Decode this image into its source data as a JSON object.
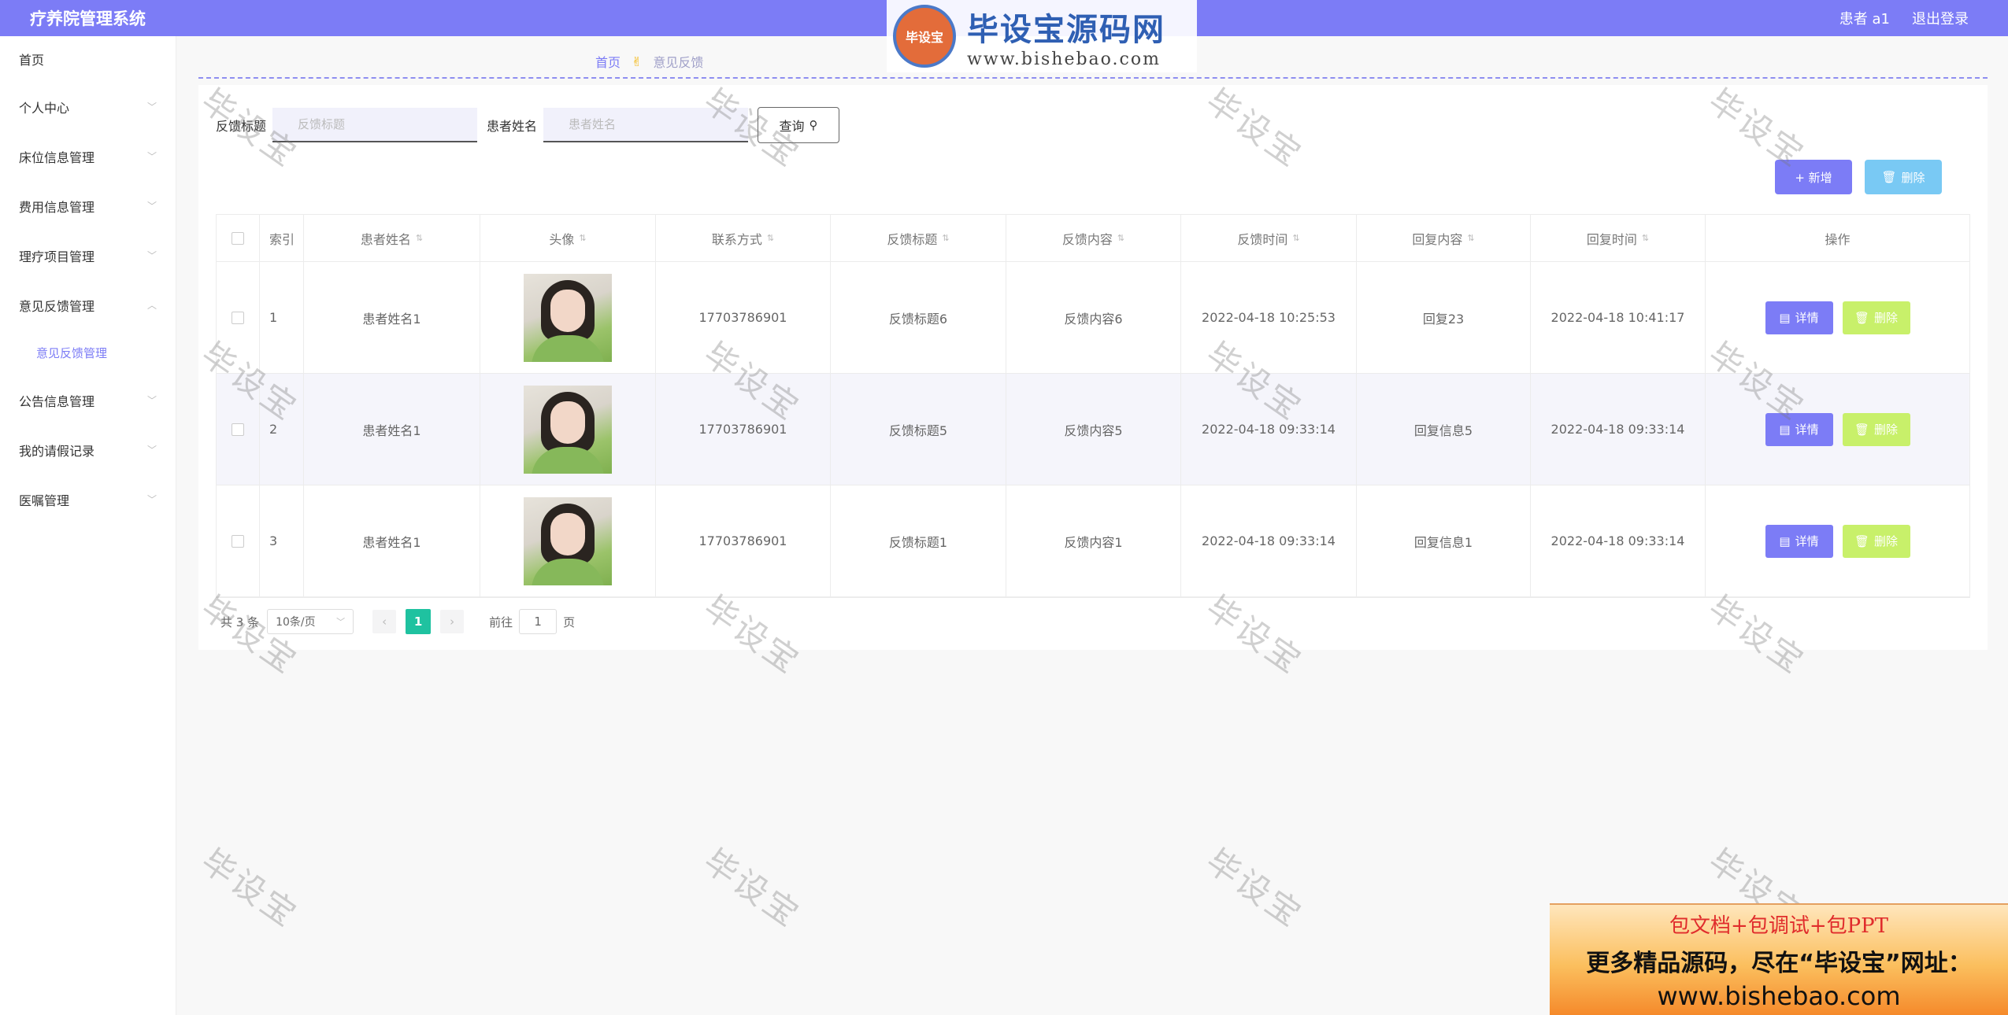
{
  "app": {
    "title": "疗养院管理系统"
  },
  "header": {
    "user": "患者 a1",
    "logout": "退出登录"
  },
  "sidebar": {
    "items": [
      {
        "label": "首页"
      },
      {
        "label": "个人中心"
      },
      {
        "label": "床位信息管理"
      },
      {
        "label": "费用信息管理"
      },
      {
        "label": "理疗项目管理"
      },
      {
        "label": "意见反馈管理"
      },
      {
        "label": "公告信息管理"
      },
      {
        "label": "我的请假记录"
      },
      {
        "label": "医嘱管理"
      }
    ],
    "sub": {
      "label": "意见反馈管理"
    }
  },
  "breadcrumb": {
    "home": "首页",
    "current": "意见反馈"
  },
  "search": {
    "title_label": "反馈标题",
    "title_placeholder": "反馈标题",
    "name_label": "患者姓名",
    "name_placeholder": "患者姓名",
    "query": "查询"
  },
  "actions": {
    "add": "+ 新增",
    "delete": "删除"
  },
  "table": {
    "headers": [
      "索引",
      "患者姓名",
      "头像",
      "联系方式",
      "反馈标题",
      "反馈内容",
      "反馈时间",
      "回复内容",
      "回复时间",
      "操作"
    ],
    "rows": [
      {
        "idx": "1",
        "name": "患者姓名1",
        "tel": "17703786901",
        "title": "反馈标题6",
        "content": "反馈内容6",
        "time": "2022-04-18 10:25:53",
        "reply": "回复23",
        "rtime": "2022-04-18 10:41:17"
      },
      {
        "idx": "2",
        "name": "患者姓名1",
        "tel": "17703786901",
        "title": "反馈标题5",
        "content": "反馈内容5",
        "time": "2022-04-18 09:33:14",
        "reply": "回复信息5",
        "rtime": "2022-04-18 09:33:14"
      },
      {
        "idx": "3",
        "name": "患者姓名1",
        "tel": "17703786901",
        "title": "反馈标题1",
        "content": "反馈内容1",
        "time": "2022-04-18 09:33:14",
        "reply": "回复信息1",
        "rtime": "2022-04-18 09:33:14"
      }
    ],
    "detail": "详情",
    "del": "删除"
  },
  "pager": {
    "total": "共 3 条",
    "size": "10条/页",
    "page": "1",
    "goto": "前往",
    "goto_value": "1",
    "page_unit": "页"
  },
  "watermark": {
    "text": "毕设宝",
    "logo_badge": "毕设宝",
    "logo_title": "毕设宝源码网",
    "logo_url": "www.bishebao.com"
  },
  "ad": {
    "line1": "包文档+包调试+包PPT",
    "line2": "更多精品源码，尽在“毕设宝”网址：",
    "line3": "www.bishebao.com"
  },
  "colors": {
    "primary": "#7c7cf6",
    "info": "#79c9f4",
    "success": "#c8f06a",
    "page_active": "#1fc2a0"
  }
}
